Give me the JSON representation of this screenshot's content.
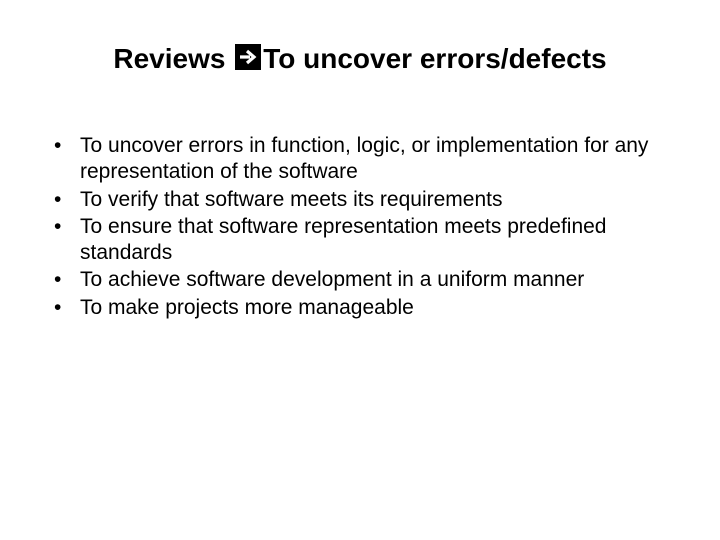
{
  "title": {
    "prefix": "Reviews ",
    "suffix": "To uncover errors/defects"
  },
  "bullets": [
    "To uncover errors in function, logic, or implementation for any representation of the software",
    "To verify that software meets its requirements",
    "To ensure that software representation meets predefined standards",
    "To achieve software development in a uniform manner",
    "To make projects more manageable"
  ]
}
